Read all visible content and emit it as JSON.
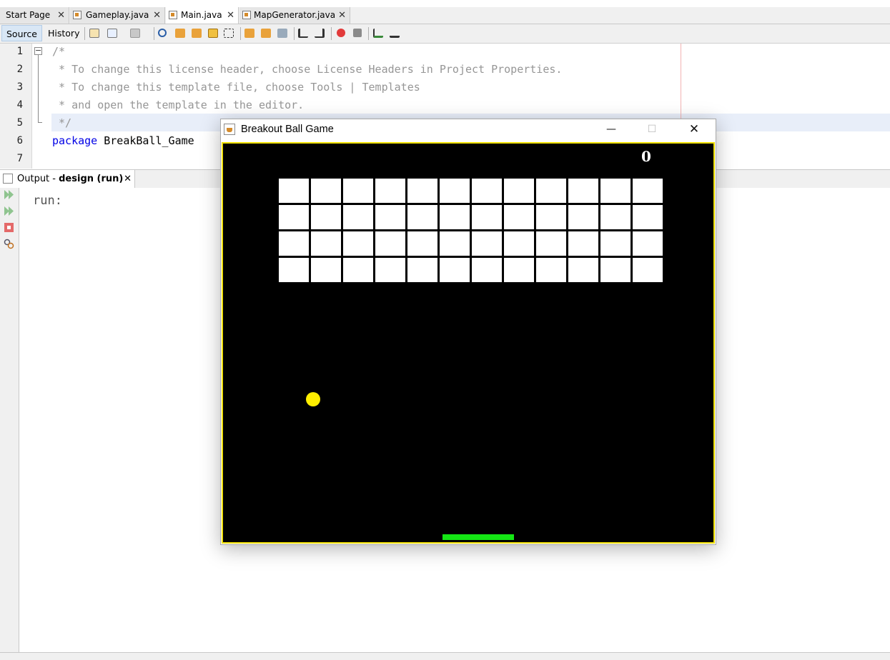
{
  "editor": {
    "tabs": [
      {
        "label": "Start Page",
        "active": false
      },
      {
        "label": "Gameplay.java",
        "active": false
      },
      {
        "label": "Main.java",
        "active": true
      },
      {
        "label": "MapGenerator.java",
        "active": false
      }
    ],
    "close_glyph": "✕",
    "toolbar": {
      "source_label": "Source",
      "history_label": "History"
    },
    "line_numbers": [
      "1",
      "2",
      "3",
      "4",
      "5",
      "6",
      "7"
    ],
    "code_lines": [
      "/*",
      " * To change this license header, choose License Headers in Project Properties.",
      " * To change this template file, choose Tools | Templates",
      " * and open the template in the editor.",
      " */"
    ],
    "package_keyword": "package",
    "package_name": "BreakBall_Game"
  },
  "output": {
    "tab_prefix": "Output - ",
    "tab_bold": "design (run)",
    "close_glyph": "✕",
    "text": "run:"
  },
  "game_window": {
    "title": "Breakout Ball Game",
    "minimize_glyph": "—",
    "maximize_glyph": "☐",
    "close_glyph": "✕",
    "score": "0",
    "brick_rows": 4,
    "brick_cols": 12,
    "colors": {
      "background": "#000000",
      "border": "#f0e000",
      "brick": "#ffffff",
      "ball": "#ffee00",
      "paddle": "#14e614"
    }
  }
}
